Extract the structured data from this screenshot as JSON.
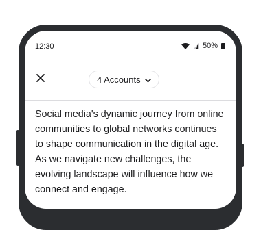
{
  "status_bar": {
    "time": "12:30",
    "battery_percent": "50%",
    "icons": [
      "wifi-icon",
      "signal-icon",
      "battery-icon"
    ]
  },
  "header": {
    "close_icon": "close-icon",
    "accounts_label": "4 Accounts",
    "dropdown_icon": "chevron-down-icon"
  },
  "post": {
    "lines": [
      "Social media's dynamic journey from online",
      "communities to global networks continues",
      "to shape communication in the digital age.",
      "As we navigate new challenges, the",
      "evolving landscape will influence how we",
      "connect and engage."
    ]
  },
  "colors": {
    "frame": "#2b2d30",
    "text": "#1d1d1f",
    "divider": "#dcdcdf"
  }
}
